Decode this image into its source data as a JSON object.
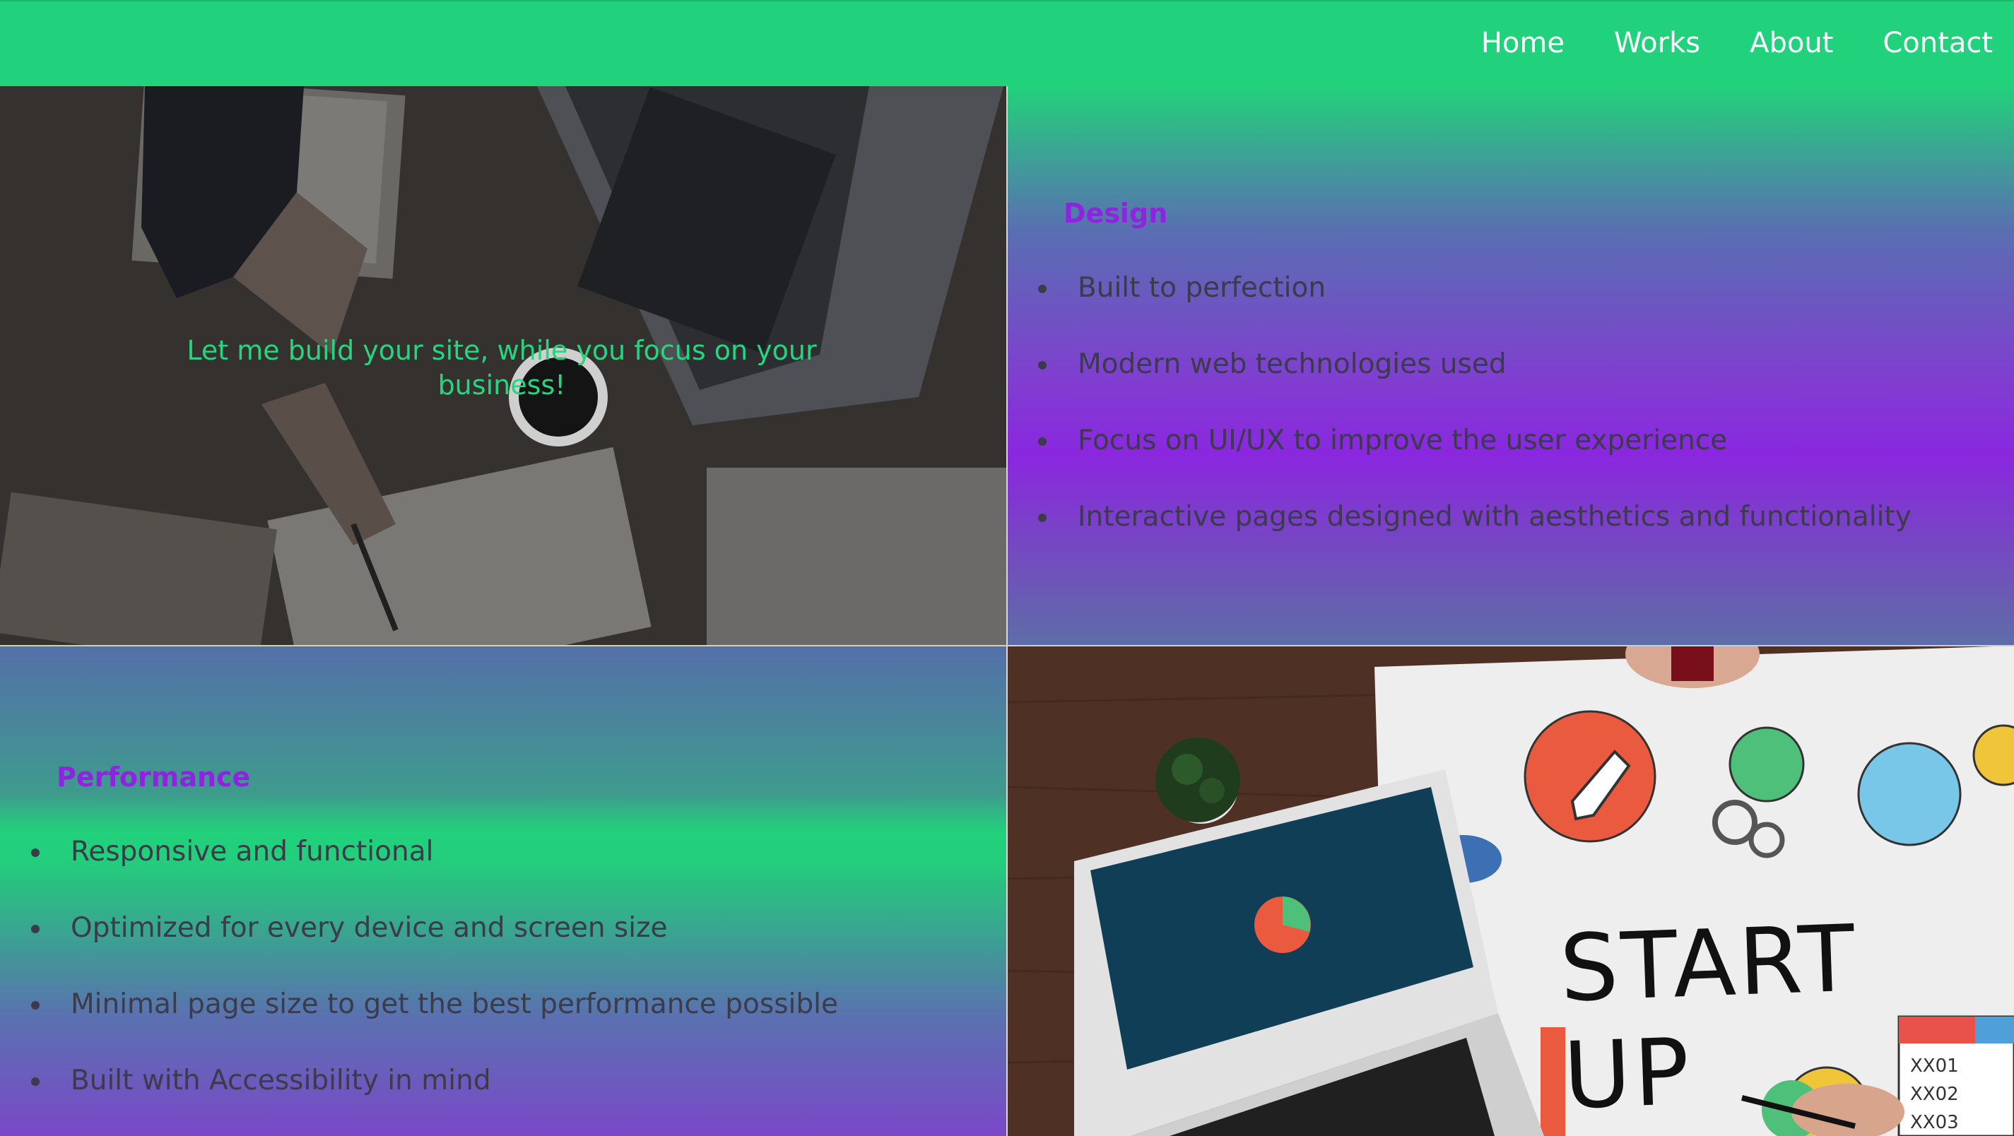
{
  "nav": {
    "items": [
      {
        "label": "Home"
      },
      {
        "label": "Works"
      },
      {
        "label": "About"
      },
      {
        "label": "Contact"
      }
    ]
  },
  "hero": {
    "tagline": "Let me build your site, while you focus on your business!"
  },
  "design": {
    "title": "Design",
    "items": [
      "Built to perfection",
      "Modern web technologies used",
      "Focus on UI/UX to improve the user experience",
      "Interactive pages designed with aesthetics and functionality"
    ]
  },
  "performance": {
    "title": "Performance",
    "items": [
      "Responsive and functional",
      "Optimized for every device and screen size",
      "Minimal page size to get the best performance possible",
      "Built with Accessibility in mind"
    ]
  },
  "startup_image": {
    "headline": "START UP",
    "checklist": [
      "XX01",
      "XX02",
      "XX03"
    ]
  },
  "colors": {
    "brand_green": "#22d17b",
    "accent_purple": "#8e24e0",
    "text_dark": "#3b3b4a"
  }
}
